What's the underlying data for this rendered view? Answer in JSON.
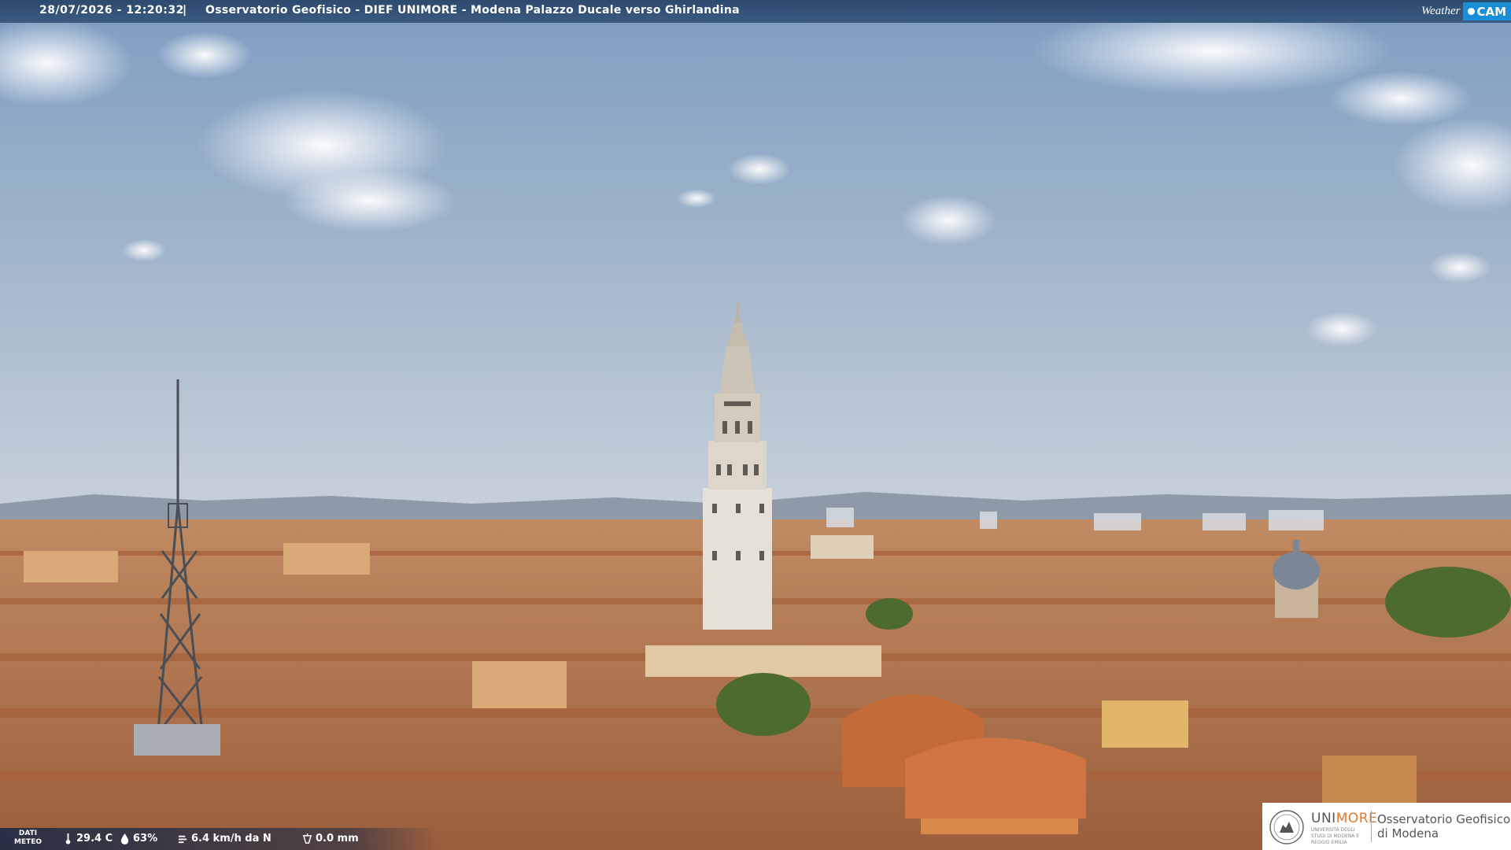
{
  "caption": {
    "timestamp": "28/07/2026 - 12:20:32",
    "separator": "|",
    "title": "Osservatorio Geofisico - DIEF UNIMORE - Modena Palazzo Ducale verso Ghirlandina"
  },
  "brand_logo": {
    "word": "Weather",
    "cam": "CAM"
  },
  "weather": {
    "label_line1": "DATI",
    "label_line2": "METEO",
    "temperature": "29.4 C",
    "humidity": "63%",
    "wind": "6.4 km/h da N",
    "rain": "0.0 mm",
    "icons": [
      "thermometer-icon",
      "humidity-drop-icon",
      "wind-icon",
      "rain-gauge-icon"
    ]
  },
  "institution": {
    "brand_prefix": "UNI",
    "brand_suffix": "MORE",
    "brand_sub": "UNIVERSITÀ DEGLI STUDI DI MODENA E REGGIO EMILIA",
    "org_line1": "Osservatorio Geofisico",
    "org_line2": "di Modena"
  },
  "colors": {
    "sky_top": "#7f9fc4",
    "sky_horizon": "#c9d3dc",
    "roofs": "#b9774c",
    "accent_orange": "#e07a2a"
  }
}
